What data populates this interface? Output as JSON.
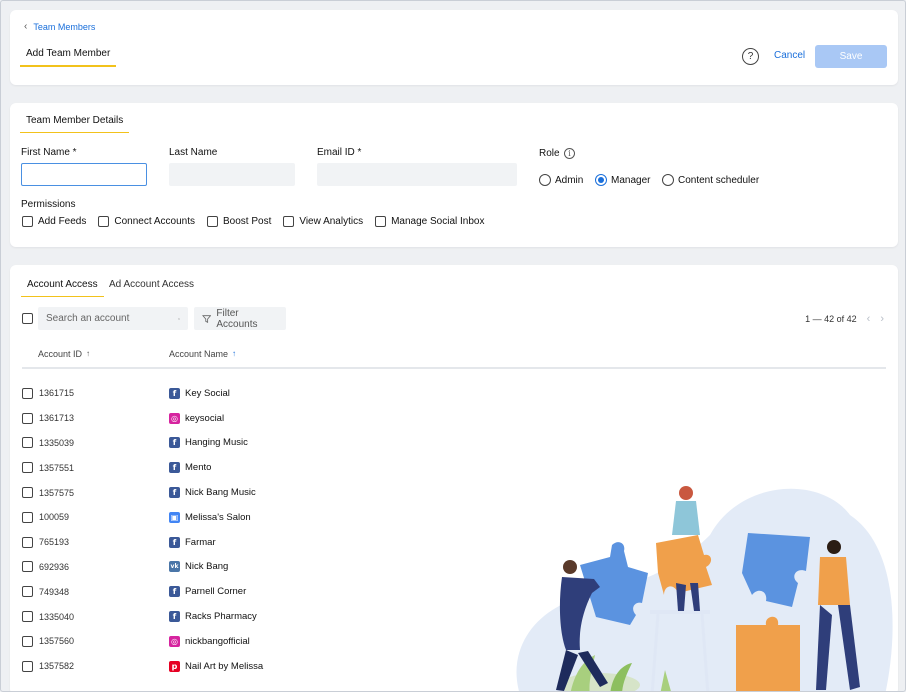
{
  "header": {
    "back_label": "Team Members",
    "title": "Add Team Member",
    "help_glyph": "?",
    "cancel_label": "Cancel",
    "save_label": "Save"
  },
  "details": {
    "section_title": "Team Member Details",
    "first_name": {
      "label": "First Name *",
      "value": ""
    },
    "last_name": {
      "label": "Last Name",
      "value": ""
    },
    "email": {
      "label": "Email ID *",
      "value": ""
    },
    "role": {
      "label": "Role",
      "options": [
        "Admin",
        "Manager",
        "Content scheduler"
      ],
      "selected": "Manager"
    },
    "permissions": {
      "label": "Permissions",
      "items": [
        "Add Feeds",
        "Connect Accounts",
        "Boost Post",
        "View Analytics",
        "Manage Social Inbox"
      ]
    }
  },
  "access": {
    "tabs": [
      "Account Access",
      "Ad Account Access"
    ],
    "active_tab": "Account Access",
    "search_placeholder": "Search an account",
    "filter_label": "Filter Accounts",
    "pagination": "1 — 42 of 42",
    "columns": {
      "id": "Account ID",
      "name": "Account Name"
    },
    "rows": [
      {
        "id": "1361715",
        "name": "Key Social",
        "network": "facebook"
      },
      {
        "id": "1361713",
        "name": "keysocial",
        "network": "instagram"
      },
      {
        "id": "1335039",
        "name": "Hanging Music",
        "network": "facebook"
      },
      {
        "id": "1357551",
        "name": "Mento",
        "network": "facebook"
      },
      {
        "id": "1357575",
        "name": "Nick Bang Music",
        "network": "facebook"
      },
      {
        "id": "100059",
        "name": "Melissa's Salon",
        "network": "google-business"
      },
      {
        "id": "765193",
        "name": "Farmar",
        "network": "facebook"
      },
      {
        "id": "692936",
        "name": "Nick Bang",
        "network": "vk"
      },
      {
        "id": "749348",
        "name": "Parnell Corner",
        "network": "facebook"
      },
      {
        "id": "1335040",
        "name": "Racks Pharmacy",
        "network": "facebook"
      },
      {
        "id": "1357560",
        "name": "nickbangofficial",
        "network": "instagram"
      },
      {
        "id": "1357582",
        "name": "Nail Art by Melissa",
        "network": "pinterest"
      }
    ]
  },
  "colors": {
    "accent": "#1a6fdb",
    "underline": "#f2c21b",
    "save_disabled": "#a9c8f5",
    "facebook": "#3b5998",
    "instagram": "#d6249f",
    "vk": "#4a76a8",
    "pinterest": "#e60023",
    "google_business": "#4285f4"
  }
}
